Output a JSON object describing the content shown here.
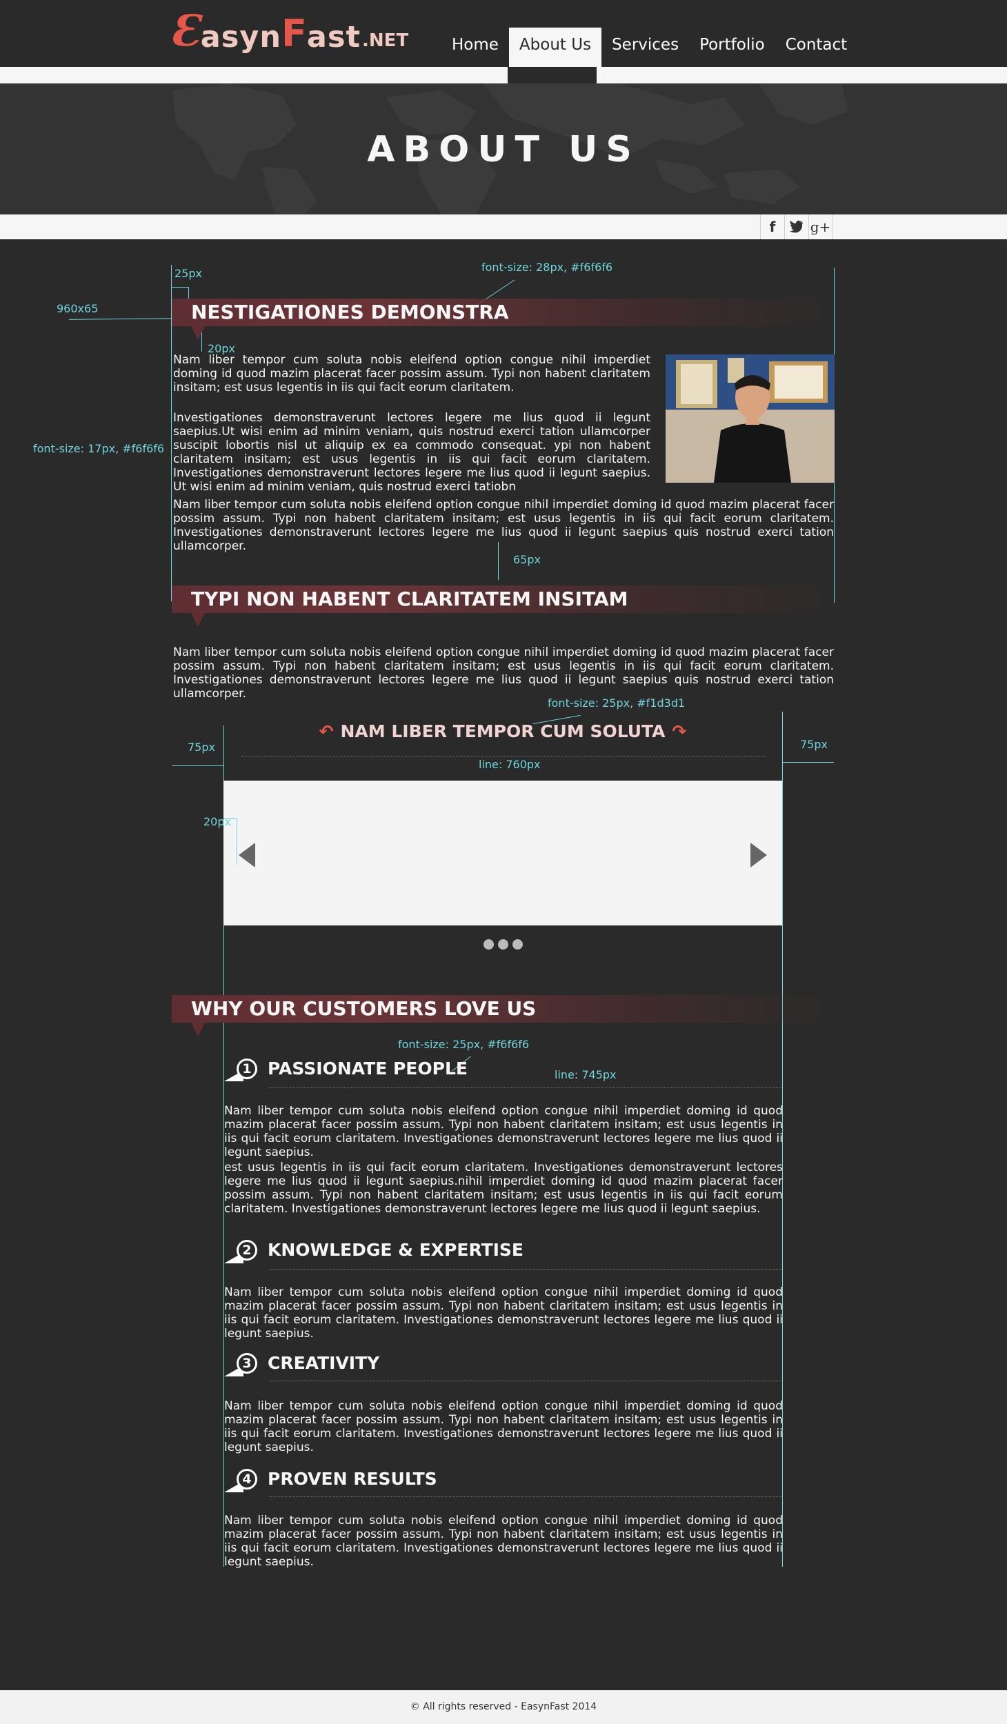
{
  "logo": {
    "e": "Ɛ",
    "asyn": "asyn",
    "f": "F",
    "ast": "ast",
    "net": ".NET"
  },
  "nav": {
    "items": [
      {
        "label": "Home"
      },
      {
        "label": "About Us"
      },
      {
        "label": "Services"
      },
      {
        "label": "Portfolio"
      },
      {
        "label": "Contact"
      }
    ]
  },
  "banner": {
    "title": "ABOUT US"
  },
  "social": {
    "facebook": "f",
    "twitter": "t",
    "gplus": "g+"
  },
  "annotations": {
    "a_25px": "25px",
    "a_fs28": "font-size: 28px, #f6f6f6",
    "a_960x65": "960x65",
    "a_20px": "20px",
    "a_fs17": "font-size: 17px, #f6f6f6",
    "a_65px": "65px",
    "a_fs25_1": "font-size: 25px, #f1d3d1",
    "a_75px_l": "75px",
    "a_75px_r": "75px",
    "a_line760": "line: 760px",
    "a_20px_2": "20px",
    "a_fs25_2": "font-size: 25px, #f6f6f6",
    "a_line745": "line: 745px"
  },
  "section1": {
    "heading": "NESTIGATIONES DEMONSTRA",
    "p1": "Nam liber tempor cum soluta nobis eleifend option congue nihil imperdiet doming id quod mazim placerat facer possim assum. Typi non habent claritatem insitam; est usus legentis in iis qui facit eorum claritatem.",
    "p2": "Investigationes demonstraverunt lectores legere me lius quod ii legunt saepius.Ut wisi enim ad minim veniam, quis nostrud exerci tation ullamcorper suscipit lobortis nisl ut aliquip ex ea commodo consequat. ypi non habent claritatem insitam; est usus legentis in iis qui facit eorum claritatem. Investigationes demonstraverunt lectores legere me lius quod ii legunt saepius. Ut wisi enim ad minim veniam, quis nostrud exerci tatiobn",
    "p3": "Nam liber tempor cum soluta nobis eleifend option congue nihil imperdiet doming id quod mazim placerat facer possim assum. Typi non habent claritatem insitam; est usus legentis in iis qui facit eorum claritatem. Investigationes demonstraverunt lectores legere me lius quod ii legunt saepius quis nostrud exerci tation ullamcorper."
  },
  "section2": {
    "heading": "TYPI NON HABENT CLARITATEM INSITAM",
    "p1": "Nam liber tempor cum soluta nobis eleifend option congue nihil imperdiet doming id quod mazim placerat facer possim assum. Typi non habent claritatem insitam; est usus legentis in iis qui facit eorum claritatem. Investigationes demonstraverunt lectores legere me lius quod ii legunt saepius quis nostrud exerci tation ullamcorper."
  },
  "slider": {
    "title": "NAM LIBER TEMPOR CUM SOLUTA",
    "dots": 3
  },
  "section3": {
    "heading": "WHY OUR CUSTOMERS LOVE US",
    "items": [
      {
        "num": "1",
        "title": "PASSIONATE PEOPLE",
        "p1": "Nam liber tempor cum soluta nobis eleifend option congue nihil imperdiet doming id quod mazim placerat facer possim assum. Typi non habent claritatem insitam; est usus legentis in iis qui facit eorum claritatem. Investigationes demonstraverunt lectores legere me lius quod ii legunt saepius.",
        "p2": "est usus legentis in iis qui facit eorum claritatem. Investigationes demonstraverunt lectores legere me lius quod ii legunt saepius.nihil imperdiet doming id quod mazim placerat facer possim assum. Typi non habent claritatem insitam; est usus legentis in iis qui facit eorum claritatem. Investigationes demonstraverunt lectores legere me lius quod ii legunt saepius."
      },
      {
        "num": "2",
        "title": "KNOWLEDGE & EXPERTISE",
        "p1": "Nam liber tempor cum soluta nobis eleifend option congue nihil imperdiet doming id quod mazim placerat facer possim assum. Typi non habent claritatem insitam; est usus legentis in iis qui facit eorum claritatem. Investigationes demonstraverunt lectores legere me lius quod ii legunt saepius."
      },
      {
        "num": "3",
        "title": "CREATIVITY",
        "p1": "Nam liber tempor cum soluta nobis eleifend option congue nihil imperdiet doming id quod mazim placerat facer possim assum. Typi non habent claritatem insitam; est usus legentis in iis qui facit eorum claritatem. Investigationes demonstraverunt lectores legere me lius quod ii legunt saepius."
      },
      {
        "num": "4",
        "title": "PROVEN RESULTS",
        "p1": "Nam liber tempor cum soluta nobis eleifend option congue nihil imperdiet doming id quod mazim placerat facer possim assum. Typi non habent claritatem insitam; est usus legentis in iis qui facit eorum claritatem. Investigationes demonstraverunt lectores legere me lius quod ii legunt saepius."
      }
    ]
  },
  "footer": {
    "text": "© All rights reserved - EasynFast 2014"
  },
  "colors": {
    "accent": "#e5574a",
    "ribbon": "#5e2e32",
    "annotation": "#6fd6dc",
    "bg": "#2a2a2a",
    "light": "#f6f6f6"
  }
}
